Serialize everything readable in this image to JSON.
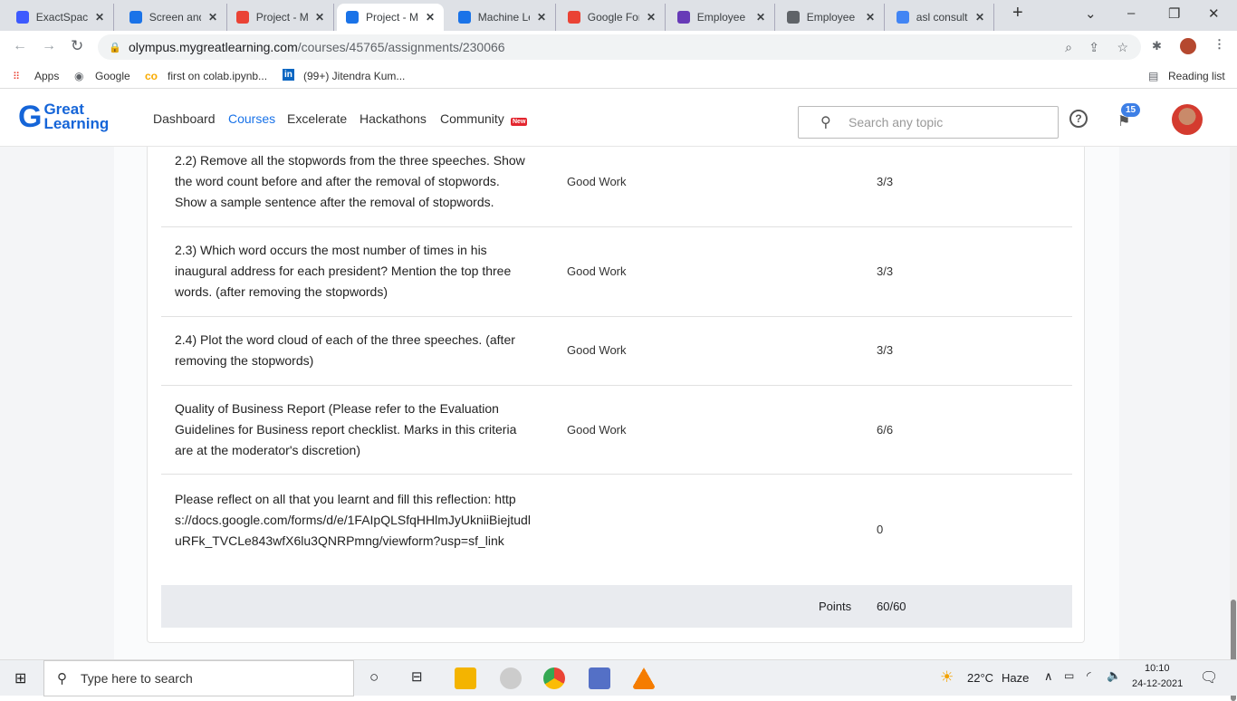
{
  "browser": {
    "tabs": [
      {
        "label": "ExactSpace",
        "icon": "exactspace-icon",
        "color": "#3d5afe"
      },
      {
        "label": "Screen and",
        "icon": "screen-icon",
        "color": "#1a73e8"
      },
      {
        "label": "Project - M",
        "icon": "gmail-icon",
        "color": "#ea4335"
      },
      {
        "label": "Project - M",
        "icon": "greatlearning-icon",
        "color": "#1a73e8",
        "active": true
      },
      {
        "label": "Machine Le",
        "icon": "greatlearning-icon",
        "color": "#1a73e8"
      },
      {
        "label": "Google For",
        "icon": "gmail-icon",
        "color": "#ea4335"
      },
      {
        "label": "Employee",
        "icon": "forms-icon",
        "color": "#673ab7"
      },
      {
        "label": "Employee",
        "icon": "globe-icon",
        "color": "#5f6368"
      },
      {
        "label": "asl consult",
        "icon": "google-icon",
        "color": "#4285f4"
      }
    ],
    "url_host": "olympus.mygreatlearning.com",
    "url_path": "/courses/45765/assignments/230066",
    "bookmarks": [
      "Apps",
      "Google",
      "first on colab.ipynb...",
      "(99+) Jitendra Kum..."
    ],
    "reading_list": "Reading list"
  },
  "site": {
    "logo_line1": "Great",
    "logo_line2": "Learning",
    "nav": [
      "Dashboard",
      "Courses",
      "Excelerate",
      "Hackathons",
      "Community"
    ],
    "new_badge": "New",
    "search_placeholder": "Search any topic",
    "notification_count": "15",
    "accent": "#1a73e8"
  },
  "rubric": [
    {
      "criterion": "2.2) Remove all the stopwords from the three speeches. Show the word count before and after the removal of stopwords. Show a sample sentence after the removal of stopwords.",
      "feedback": "Good Work",
      "marks": "3/3"
    },
    {
      "criterion": "2.3) Which word occurs the most number of times in his inaugural address for each president? Mention the top three words. (after removing the stopwords)",
      "feedback": "Good Work",
      "marks": "3/3"
    },
    {
      "criterion": "2.4) Plot the word cloud of each of the three speeches. (after removing the stopwords)",
      "feedback": "Good Work",
      "marks": "3/3"
    },
    {
      "criterion": "Quality of Business Report (Please refer to the Evaluation Guidelines for Business report checklist. Marks in this criteria are at the moderator's discretion)",
      "feedback": "Good Work",
      "marks": "6/6"
    },
    {
      "criterion": "Please reflect on all that you learnt and fill this reflection: https://docs.google.com/forms/d/e/1FAIpQLSfqHHlmJyUkniiBiejtudluRFk_TVCLe843wfX6lu3QNRPmng/viewform?usp=sf_link",
      "feedback": "",
      "marks": "0"
    }
  ],
  "totals": {
    "label": "Points",
    "value": "60/60"
  },
  "taskbar": {
    "search_placeholder": "Type here to search",
    "temperature": "22°C",
    "weather": "Haze",
    "time": "10:10",
    "date": "24-12-2021"
  }
}
